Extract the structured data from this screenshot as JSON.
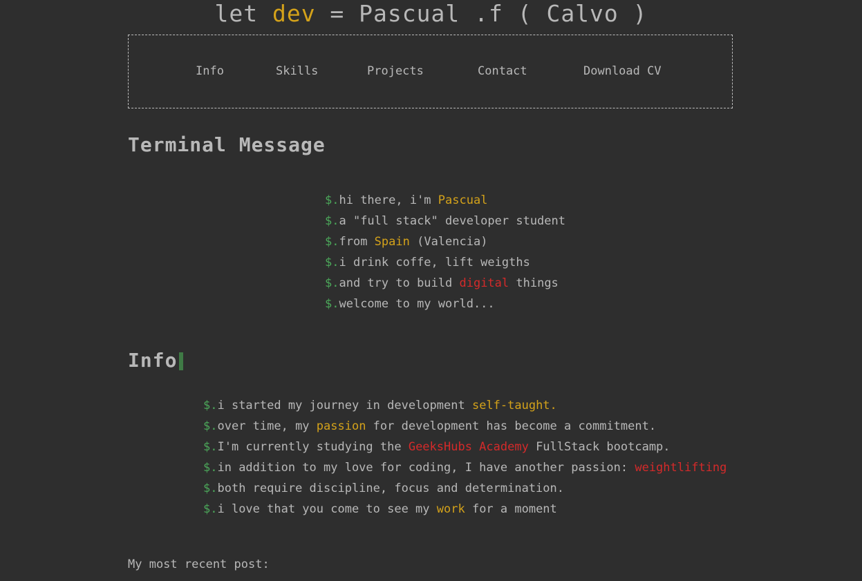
{
  "header": {
    "title_parts": [
      "let ",
      "dev",
      " = Pascual .f ( Calvo )"
    ]
  },
  "nav": {
    "items": [
      "Info",
      "Skills",
      "Projects",
      "Contact",
      "Download CV"
    ]
  },
  "terminal_section": {
    "title": "Terminal Message",
    "prompt": "$.",
    "lines": [
      [
        "hi there, i'm ",
        "Pascual",
        ""
      ],
      [
        "a \"full stack\" developer student",
        "",
        ""
      ],
      [
        "from ",
        "Spain",
        " (Valencia)"
      ],
      [
        "i drink coffe, lift weigths",
        "",
        ""
      ],
      [
        "and try to build ",
        "digital",
        " things"
      ],
      [
        "welcome to my world...",
        "",
        ""
      ]
    ]
  },
  "info_section": {
    "title": "Info",
    "prompt": "$.",
    "lines": [
      [
        "i started my journey in development ",
        "self-taught.",
        ""
      ],
      [
        "over time, my ",
        "passion",
        " for development has become a commitment."
      ],
      [
        "I'm currently studying the ",
        "GeeksHubs Academy",
        " FullStack bootcamp."
      ],
      [
        "in addition to my love for coding, I have another passion: ",
        "weightlifting",
        ""
      ],
      [
        "both require discipline, focus and determination.",
        "",
        ""
      ],
      [
        "i love that you come to see my ",
        "work",
        " for a moment"
      ]
    ]
  },
  "recent_post": {
    "label": "My most recent post:"
  },
  "colors": {
    "background": "#2e2e2e",
    "text": "#b8b8b8",
    "accent_yellow": "#d4a21a",
    "accent_red": "#d42a2a",
    "prompt_green": "#4ca85a"
  }
}
